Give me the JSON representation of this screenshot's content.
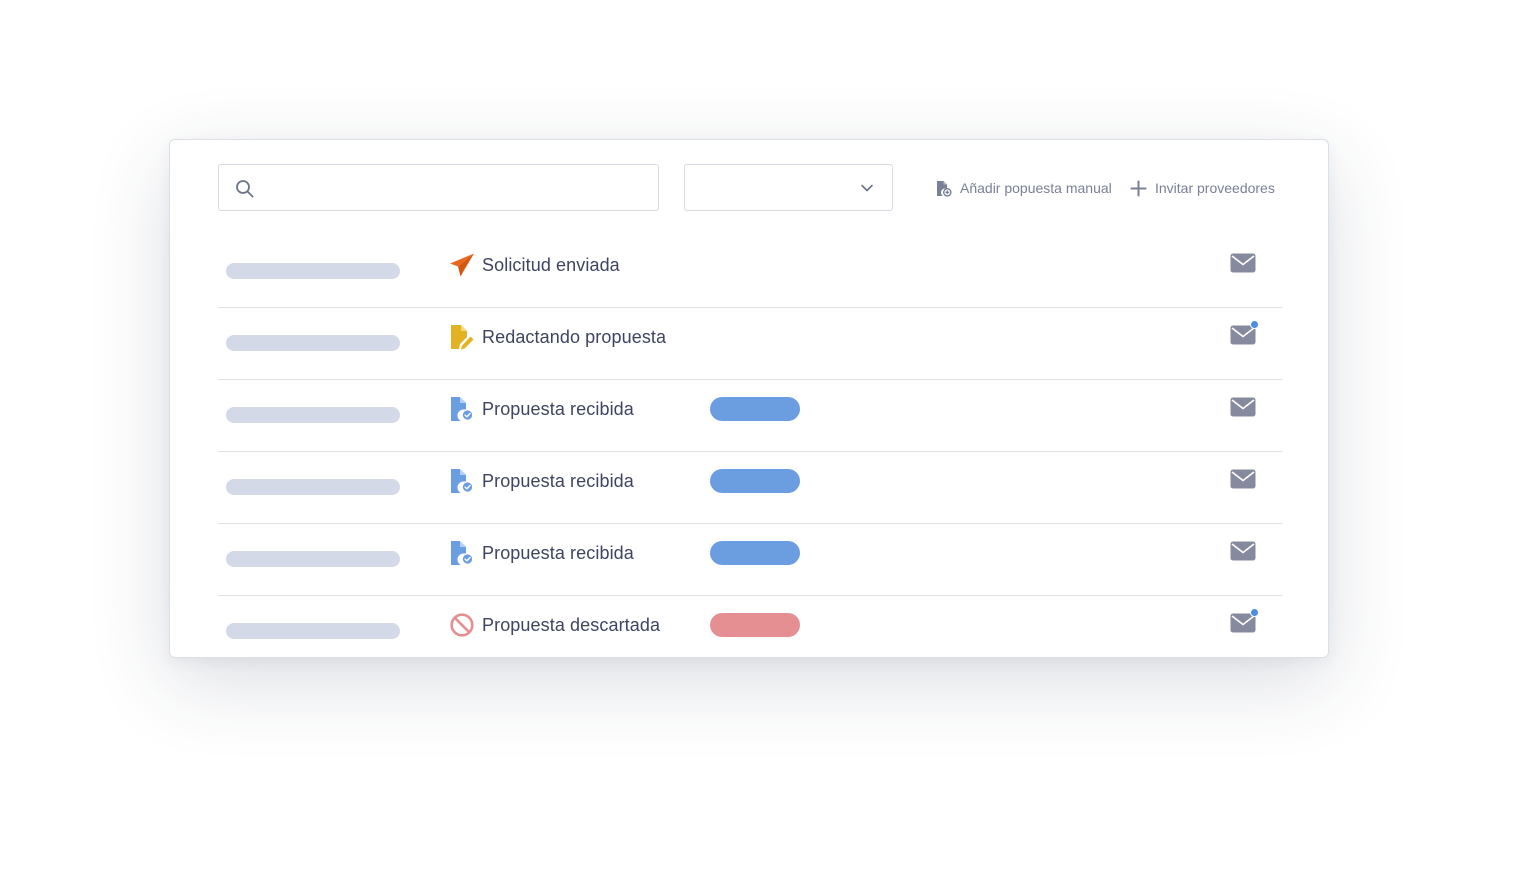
{
  "toolbar": {
    "search_placeholder": "",
    "filter_value": "",
    "add_manual_label": "Añadir popuesta manual",
    "invite_label": "Invitar proveedores"
  },
  "colors": {
    "sent": "#e8691e",
    "drafting": "#e2b223",
    "received": "#6b9ee0",
    "discarded": "#e58f92",
    "mail": "#858a9e",
    "notification_dot": "#4a8ee8"
  },
  "rows": [
    {
      "status_label": "Solicitud enviada",
      "status_icon": "paper-plane-icon",
      "pill": null,
      "unread": false
    },
    {
      "status_label": "Redactando propuesta",
      "status_icon": "document-edit-icon",
      "pill": null,
      "unread": true
    },
    {
      "status_label": "Propuesta recibida",
      "status_icon": "document-check-icon",
      "pill": "received",
      "unread": false
    },
    {
      "status_label": "Propuesta recibida",
      "status_icon": "document-check-icon",
      "pill": "received",
      "unread": false
    },
    {
      "status_label": "Propuesta recibida",
      "status_icon": "document-check-icon",
      "pill": "received",
      "unread": false
    },
    {
      "status_label": "Propuesta descartada",
      "status_icon": "ban-icon",
      "pill": "discarded",
      "unread": true
    }
  ]
}
